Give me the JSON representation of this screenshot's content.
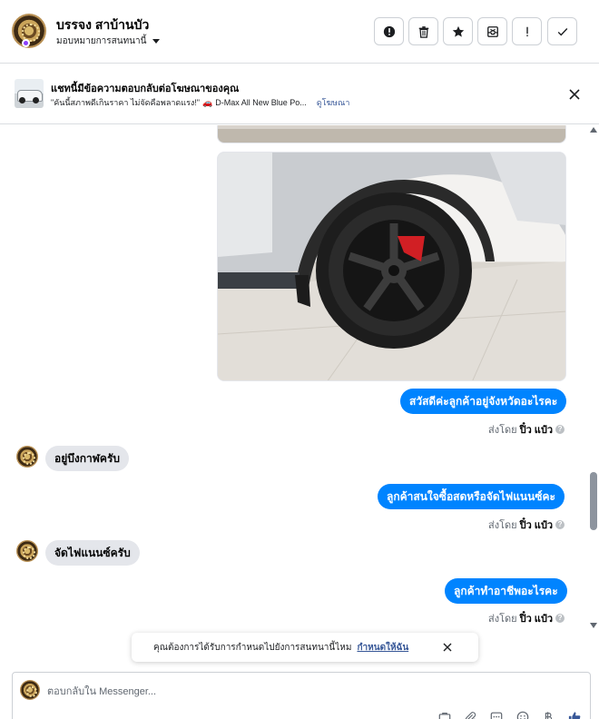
{
  "header": {
    "contact_name": "บรรจง สาบ้านบัว",
    "assign_label": "มอบหมายการสนทนานี้",
    "buttons": [
      {
        "name": "mark-spam-button",
        "icon": "alert-circle-icon"
      },
      {
        "name": "delete-button",
        "icon": "trash-icon"
      },
      {
        "name": "star-button",
        "icon": "star-icon"
      },
      {
        "name": "move-to-inbox-button",
        "icon": "inbox-icon"
      },
      {
        "name": "follow-up-button",
        "icon": "exclamation-icon"
      },
      {
        "name": "mark-done-button",
        "icon": "check-icon"
      }
    ]
  },
  "ad_bar": {
    "title": "แชทนี้มีข้อความตอบกลับต่อโฆษณาของคุณ",
    "subtitle": "\"คันนี้สภาพดีเกินราคา ไม่จัดคือพลาดแรง!\"",
    "subtitle_emoji": "🚗",
    "ad_name": "D-Max All New Blue Po...",
    "view_ad_link": "ดูโฆษณา"
  },
  "messages": {
    "out1": "สวัสดีค่ะลูกค้าอยู่จังหวัดอะไรคะ",
    "in1": "อยู่บึงกาฬครับ",
    "out2": "ลูกค้าสนใจซื้อสดหรือจัดไฟแนนซ์คะ",
    "in2": "จัดไฟแนนซ์ครับ",
    "out3": "ลูกค้าทำอาชีพอะไรคะ",
    "sent_by_prefix": "ส่งโดย",
    "sent_by_name": "ปิ๋ว แป๋ว",
    "info_glyph": "?"
  },
  "toast": {
    "text": "คุณต้องการได้รับการกำหนดไปยังการสนทนานี้ไหม",
    "link": "กำหนดให้ฉัน"
  },
  "composer": {
    "placeholder": "ตอบกลับใน Messenger..."
  },
  "colors": {
    "accent": "#0084ff",
    "incoming_bubble": "#e4e6eb",
    "link": "#385898"
  }
}
